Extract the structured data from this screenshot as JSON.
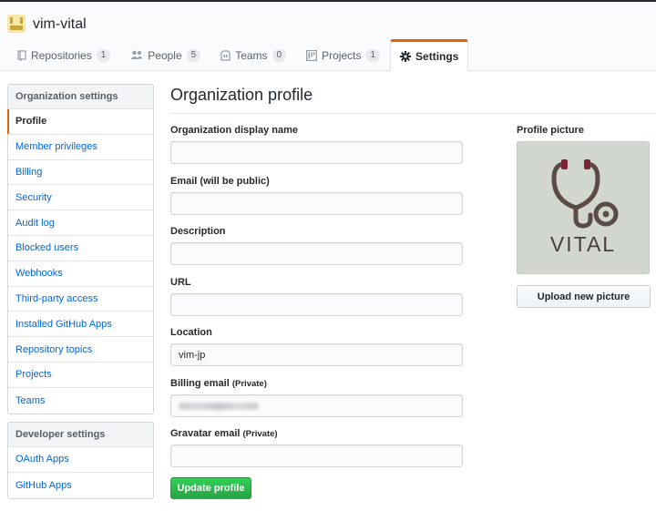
{
  "org": {
    "name": "vim-vital"
  },
  "tabs": [
    {
      "label": "Repositories",
      "count": "1",
      "icon": "repo-icon"
    },
    {
      "label": "People",
      "count": "5",
      "icon": "people-icon"
    },
    {
      "label": "Teams",
      "count": "0",
      "icon": "jersey-icon"
    },
    {
      "label": "Projects",
      "count": "1",
      "icon": "project-icon"
    },
    {
      "label": "Settings",
      "icon": "gear-icon",
      "selected": true
    }
  ],
  "sidebar": {
    "org_settings": {
      "heading": "Organization settings",
      "items": [
        "Profile",
        "Member privileges",
        "Billing",
        "Security",
        "Audit log",
        "Blocked users",
        "Webhooks",
        "Third-party access",
        "Installed GitHub Apps",
        "Repository topics",
        "Projects",
        "Teams"
      ],
      "selected_index": 0
    },
    "dev_settings": {
      "heading": "Developer settings",
      "items": [
        "OAuth Apps",
        "GitHub Apps"
      ]
    }
  },
  "main": {
    "title": "Organization profile",
    "fields": {
      "display_name": {
        "label": "Organization display name",
        "value": ""
      },
      "email": {
        "label": "Email (will be public)",
        "value": ""
      },
      "description": {
        "label": "Description",
        "value": ""
      },
      "url": {
        "label": "URL",
        "value": ""
      },
      "location": {
        "label": "Location",
        "value": "vim-jp"
      },
      "billing_email": {
        "label": "Billing email",
        "note": "(Private)",
        "value": ""
      },
      "gravatar_email": {
        "label": "Gravatar email",
        "note": "(Private)",
        "value": ""
      }
    },
    "update_button": "Update profile"
  },
  "profile_picture": {
    "label": "Profile picture",
    "logo_text": "VITAL",
    "upload_button": "Upload new picture"
  },
  "colors": {
    "accent_tab": "#e36209",
    "link": "#0366d6",
    "update_button": "#28a745",
    "logo_bg": "#d1d7cf",
    "logo_stroke": "#5a4a48",
    "logo_accent": "#7b2638"
  }
}
